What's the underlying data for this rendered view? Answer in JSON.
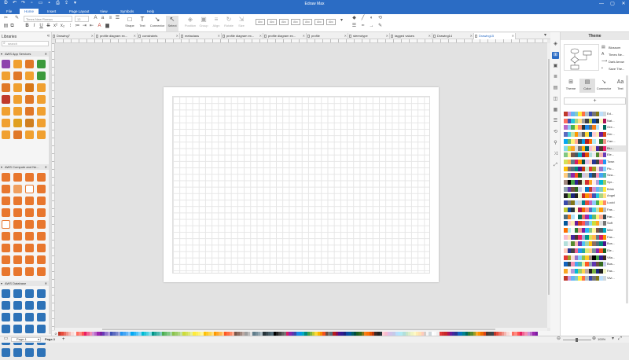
{
  "app": {
    "title": "Edraw Max",
    "window_controls": [
      "—",
      "▢",
      "✕"
    ],
    "quick_access": [
      "undo",
      "redo",
      "new",
      "open",
      "save",
      "print",
      "export",
      "more"
    ]
  },
  "menu": [
    "File",
    "Home",
    "Insert",
    "Page Layout",
    "View",
    "Symbols",
    "Help"
  ],
  "menu_active": "Home",
  "ribbon": {
    "font_name": "Times New Roman",
    "font_size": "12",
    "buttons": [
      {
        "name": "shape",
        "label": "Shape",
        "icon": "□",
        "enabled": true
      },
      {
        "name": "text",
        "label": "Text",
        "icon": "T",
        "enabled": true
      },
      {
        "name": "connector",
        "label": "Connector",
        "icon": "↘",
        "enabled": true
      },
      {
        "name": "select",
        "label": "Select",
        "icon": "↖",
        "enabled": true,
        "selected": true
      },
      {
        "name": "position",
        "label": "Position",
        "icon": "◈",
        "enabled": false
      },
      {
        "name": "group",
        "label": "Group",
        "icon": "▣",
        "enabled": false
      },
      {
        "name": "align",
        "label": "Align",
        "icon": "≡",
        "enabled": false
      },
      {
        "name": "rotate",
        "label": "Rotate",
        "icon": "↻",
        "enabled": false
      },
      {
        "name": "size",
        "label": "Size",
        "icon": "⇲",
        "enabled": false
      }
    ],
    "style_presets": [
      "Abc",
      "Abc",
      "Abc",
      "Abc",
      "Abc",
      "Abc",
      "Abc"
    ]
  },
  "left_panel": {
    "title": "Libraries",
    "search_placeholder": "search",
    "libraries": [
      {
        "name": "AWS App Services",
        "colors": [
          "#8e44ad",
          "#f0a030",
          "#e07828",
          "#3c9a3c",
          "#f0a030",
          "#e07828",
          "#f0a030",
          "#3c9a3c",
          "#e07828",
          "#f0a030",
          "#d87818",
          "#f0a030",
          "#c0392b",
          "#f0a030",
          "#e07828",
          "#f0a030",
          "#f0a030",
          "#f0a030",
          "#e07828",
          "#f0a030",
          "#f0a030",
          "#e0a020",
          "#d08020",
          "#f0a030",
          "#f0a030",
          "#e07828",
          "#f0a030",
          "#f0a030"
        ]
      },
      {
        "name": "AWS Compute and Ne...",
        "colors": [
          "#e8772e",
          "#e8772e",
          "#e8772e",
          "#e8772e",
          "#e8772e",
          "#f0a060",
          "#ffffff",
          "#e8772e",
          "#e8772e",
          "#e8772e",
          "#e8772e",
          "#e8772e",
          "#e8772e",
          "#e8772e",
          "#e8772e",
          "#e8772e",
          "#ffffff",
          "#e8772e",
          "#e8772e",
          "#e8772e",
          "#e8772e",
          "#e8772e",
          "#e8772e",
          "#e8772e",
          "#e8772e",
          "#e8772e",
          "#e8772e",
          "#e8772e",
          "#e8772e",
          "#e8772e",
          "#e8772e",
          "#e8772e",
          "#e8772e",
          "#e8772e",
          "#e8772e",
          "#e8772e"
        ]
      },
      {
        "name": "AWS Database",
        "colors": [
          "#2e73b8",
          "#2e73b8",
          "#2e73b8",
          "#2e73b8",
          "#2e73b8",
          "#2e73b8",
          "#2e73b8",
          "#2e73b8",
          "#2e73b8",
          "#2e73b8",
          "#2e73b8",
          "#2e73b8",
          "#2e73b8",
          "#2e73b8",
          "#2e73b8",
          "#2e73b8",
          "#2e73b8",
          "#2e73b8",
          "#2e73b8",
          "#2e73b8",
          "#2e73b8",
          "#2e73b8",
          "#2e73b8",
          "#2e73b8"
        ]
      }
    ]
  },
  "tabs": [
    "Drawing7",
    "profile diagram ex...",
    "constraints",
    "metaclass",
    "profile diagram ex...",
    "profile diagram ex...",
    "profile",
    "stereotype",
    "tagged values",
    "Drawing14",
    "Drawing15"
  ],
  "active_tab": "Drawing15",
  "status": {
    "page_selector": "Page-1",
    "page_tab": "Page-1",
    "add_page": "+",
    "zoom": "100%"
  },
  "right_panel": {
    "title": "Theme",
    "options": [
      "Blossom",
      "Times Ne...",
      "Dark Arrow",
      "Save The..."
    ],
    "tools": [
      {
        "label": "Theme",
        "icon": "⊞"
      },
      {
        "label": "Color",
        "icon": "▤",
        "selected": true
      },
      {
        "label": "Connector",
        "icon": "↘"
      },
      {
        "label": "Text",
        "icon": "Aa"
      }
    ],
    "add_label": "+",
    "themes": [
      "Ed...",
      "Nat...",
      "Ore...",
      "Ger...",
      "Can...",
      "Blu...",
      "Ele...",
      "Town",
      "Pic...",
      "Sea...",
      "Spr...",
      "Brisk",
      "Angel",
      "Lucid",
      "Fas...",
      "Har...",
      "Soft",
      "Mild",
      "Fas...",
      "Bus...",
      "Ele...",
      "Vita...",
      "Bus...",
      "Fas...",
      "Vivi..."
    ],
    "selected_theme": "Blu..."
  },
  "colors": {
    "accent": "#2b6cc4",
    "palette": [
      "#c0392b",
      "#e74c3c",
      "#ec7063",
      "#f1948a",
      "#f5b7b1",
      "#fadbd8",
      "#fdedec",
      "#ff6f61",
      "#ff8a80",
      "#ff5252",
      "#e91e63",
      "#f06292",
      "#f48fb1",
      "#ce93d8",
      "#ba68c8",
      "#9c27b0",
      "#7b1fa2",
      "#673ab7",
      "#9575cd",
      "#b39ddb",
      "#3f51b5",
      "#5c6bc0",
      "#7986cb",
      "#9fa8da",
      "#2196f3",
      "#42a5f5",
      "#64b5f6",
      "#90caf9",
      "#03a9f4",
      "#29b6f6",
      "#4fc3f7",
      "#81d4fa",
      "#00bcd4",
      "#26c6da",
      "#4dd0e1",
      "#80deea",
      "#009688",
      "#26a69a",
      "#4db6ac",
      "#80cbc4",
      "#4caf50",
      "#66bb6a",
      "#81c784",
      "#a5d6a7",
      "#8bc34a",
      "#9ccc65",
      "#aed581",
      "#c5e1a5",
      "#cddc39",
      "#d4e157",
      "#dce775",
      "#e6ee9c",
      "#ffeb3b",
      "#ffee58",
      "#fff176",
      "#fff59d",
      "#ffc107",
      "#ffca28",
      "#ffd54f",
      "#ffe082",
      "#ff9800",
      "#ffa726",
      "#ffb74d",
      "#ffcc80",
      "#ff5722",
      "#ff7043",
      "#ff8a65",
      "#ffab91",
      "#795548",
      "#8d6e63",
      "#a1887f",
      "#bcaaa4",
      "#9e9e9e",
      "#bdbdbd",
      "#e0e0e0",
      "#607d8b",
      "#78909c",
      "#90a4ae",
      "#b0bec5",
      "#263238",
      "#37474f",
      "#455a64",
      "#546e7a",
      "#000000",
      "#212121",
      "#424242",
      "#616161",
      "#757575",
      "#d81b60",
      "#8e24aa",
      "#5e35b1",
      "#3949ab",
      "#1e88e5",
      "#039be5",
      "#00acc1",
      "#00897b",
      "#43a047",
      "#7cb342",
      "#c0ca33",
      "#fdd835",
      "#ffb300",
      "#fb8c00",
      "#f4511e",
      "#6d4c41",
      "#757575",
      "#546e7a",
      "#b71c1c",
      "#880e4f",
      "#4a148c",
      "#311b92",
      "#1a237e",
      "#0d47a1",
      "#01579b",
      "#006064",
      "#004d40",
      "#1b5e20",
      "#33691e",
      "#827717",
      "#f57f17",
      "#ff6f00",
      "#e65100",
      "#bf360c",
      "#3e2723",
      "#212121",
      "#263238",
      "#ffcdd2",
      "#f8bbd0",
      "#e1bee7",
      "#d1c4e9",
      "#c5cae9",
      "#bbdefb",
      "#b3e5fc",
      "#b2ebf2",
      "#b2dfdb",
      "#c8e6c9",
      "#dcedc8",
      "#f0f4c3",
      "#fff9c4",
      "#ffecb3",
      "#ffe0b2",
      "#ffccbc",
      "#d7ccc8",
      "#f5f5f5",
      "#cfd8dc",
      "#ffffff",
      "#fafafa",
      "#eeeeee",
      "#e53935",
      "#d32f2f",
      "#c62828",
      "#ad1457",
      "#6a1b9a",
      "#4527a0",
      "#283593",
      "#1565c0",
      "#0277bd",
      "#00838f",
      "#00695c",
      "#2e7d32",
      "#558b2f",
      "#9e9d24",
      "#f9a825",
      "#ff8f00",
      "#ef6c00",
      "#d84315",
      "#4e342e",
      "#424242",
      "#37474f"
    ]
  }
}
